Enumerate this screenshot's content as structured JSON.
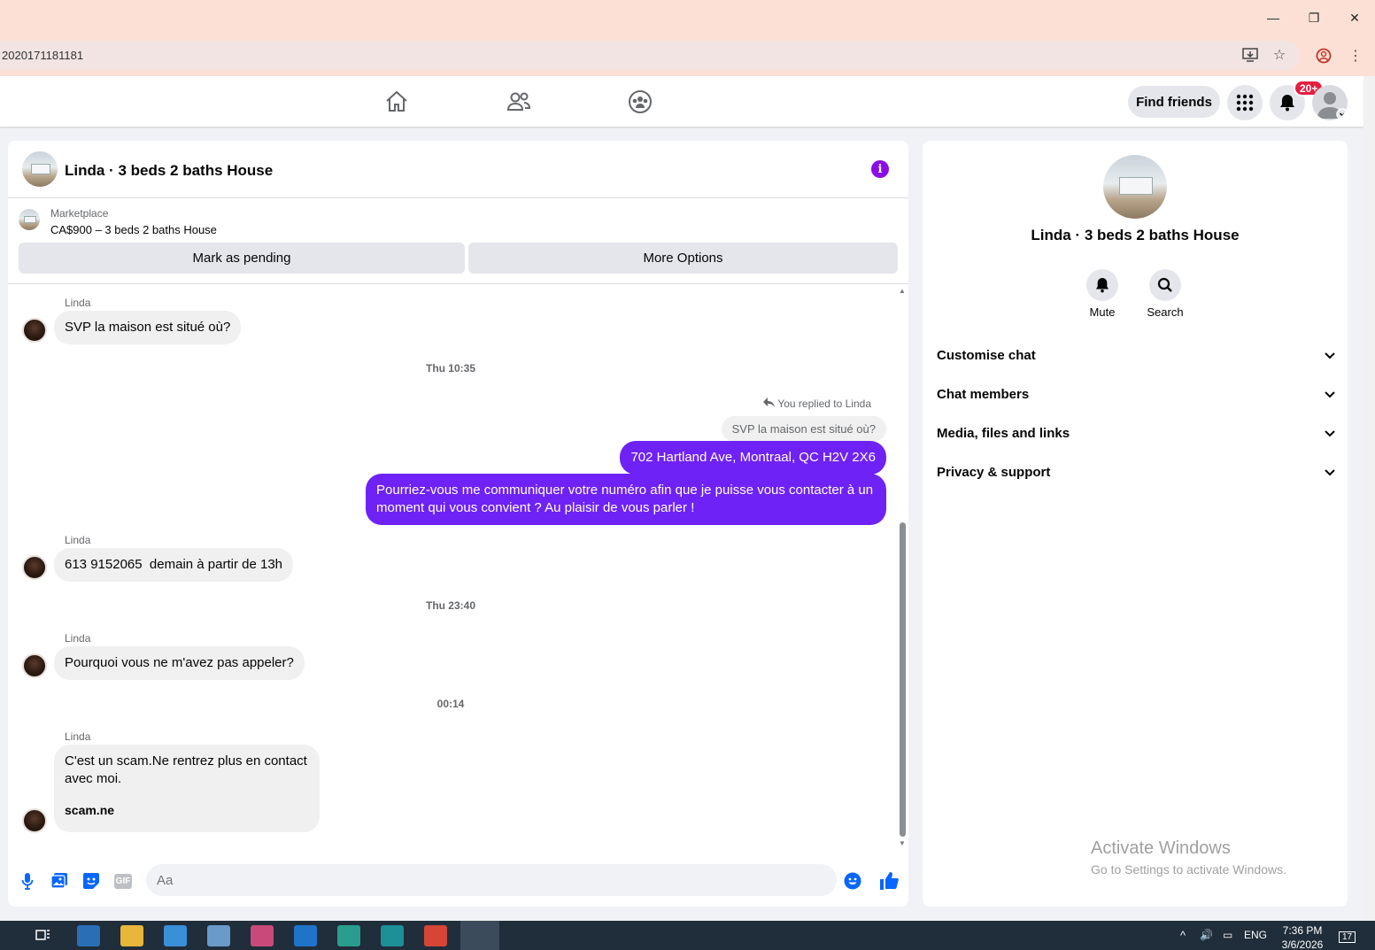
{
  "browser": {
    "url_fragment": "2020171181181",
    "window_controls": {
      "minimize": "—",
      "restore": "❐",
      "close": "✕"
    }
  },
  "nav": {
    "find_friends": "Find friends",
    "notif_count": "20+"
  },
  "chat": {
    "title": "Linda · 3 beds 2 baths House",
    "marketplace_label": "Marketplace",
    "listing": "CA$900 – 3 beds 2 baths House",
    "mark_pending": "Mark as pending",
    "more_options": "More Options",
    "messages": [
      {
        "sender": "Linda",
        "text": "SVP la maison est situé où?"
      },
      {
        "timestamp": "Thu 10:35"
      },
      {
        "reply_note": "You replied to Linda",
        "quoted": "SVP la maison est situé où?"
      },
      {
        "out1": "702 Hartland Ave, Montraal, QC H2V 2X6"
      },
      {
        "out2": "Pourriez-vous me communiquer votre numéro afin que je puisse vous contacter à un moment qui vous convient ? Au plaisir de vous parler !"
      },
      {
        "sender": "Linda",
        "text": "613 9152065  demain à partir de 13h"
      },
      {
        "timestamp": "Thu 23:40"
      },
      {
        "sender": "Linda",
        "text": "Pourquoi vous ne m'avez pas appeler?"
      },
      {
        "timestamp": "00:14"
      },
      {
        "sender": "Linda",
        "text": "C'est un scam.Ne rentrez plus en contact avec moi.",
        "link": "scam.ne"
      }
    ],
    "composer_placeholder": "Aa",
    "composer_icons": [
      "microphone-icon",
      "photo-icon",
      "sticker-icon",
      "gif-icon"
    ],
    "gif_label": "GIF"
  },
  "info": {
    "title": "Linda · 3 beds 2 baths House",
    "mute": "Mute",
    "search": "Search",
    "sections": [
      "Customise chat",
      "Chat members",
      "Media, files and links",
      "Privacy & support"
    ],
    "activate_title": "Activate Windows",
    "activate_sub": "Go to Settings to activate Windows."
  },
  "taskbar": {
    "lang": "ENG",
    "time": "7:36 PM",
    "date": "3/6/2026",
    "notif": "17"
  },
  "colors": {
    "accent": "#6e22f5",
    "info": "#8a0de6",
    "badge": "#e41e3f"
  }
}
